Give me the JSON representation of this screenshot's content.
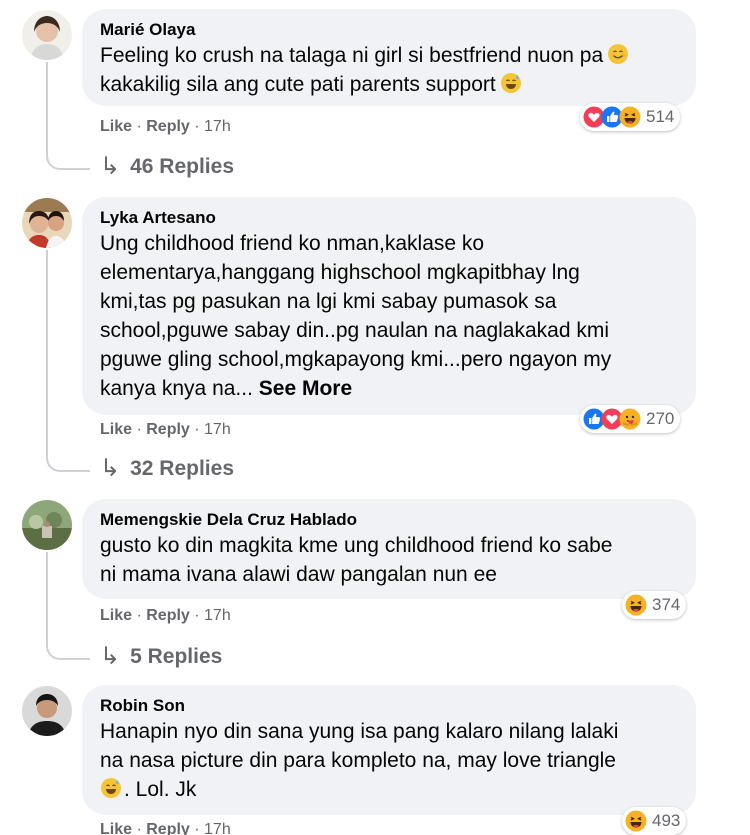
{
  "comments": [
    {
      "author": "Marié Olaya",
      "lines": [
        "Feeling ko crush na talaga ni girl si bestfriend nuon pa",
        "kakakilig sila ang cute pati parents support"
      ],
      "reaction_count": "514",
      "like_label": "Like",
      "reply_label": "Reply",
      "time": "17h",
      "replies_label": "46 Replies"
    },
    {
      "author": "Lyka Artesano",
      "lines": [
        "Ung childhood friend ko nman,kaklase ko",
        "elementarya,hanggang highschool mgkapitbhay lng",
        "kmi,tas pg pasukan na lgi kmi sabay pumasok sa",
        "school,pguwe sabay din..pg naulan na naglakakad kmi",
        "pguwe gling school,mgkapayong kmi...pero ngayon my",
        "kanya knya na..."
      ],
      "see_more": "See More",
      "reaction_count": "270",
      "like_label": "Like",
      "reply_label": "Reply",
      "time": "17h",
      "replies_label": "32 Replies"
    },
    {
      "author": "Memengskie Dela Cruz Hablado",
      "lines": [
        "gusto ko din magkita kme ung childhood friend ko sabe",
        "ni mama ivana alawi daw pangalan nun ee"
      ],
      "reaction_count": "374",
      "like_label": "Like",
      "reply_label": "Reply",
      "time": "17h",
      "replies_label": "5 Replies"
    },
    {
      "author": "Robin Son",
      "lines": [
        "Hanapin nyo din sana yung isa pang kalaro nilang lalaki",
        "na nasa picture din para kompleto na, may love triangle",
        ". Lol. Jk"
      ],
      "reaction_count": "493",
      "like_label": "Like",
      "reply_label": "Reply",
      "time": "17h"
    }
  ],
  "colors": {
    "bubble": "#f0f2f5",
    "meta": "#65676b",
    "love": "#f33e58",
    "like": "#1877f2",
    "haha": "#f7b125"
  },
  "icons": [
    "love-reaction-icon",
    "like-reaction-icon",
    "haha-reaction-icon",
    "care-reaction-icon",
    "smile-emoji-icon",
    "sweat-smile-emoji-icon",
    "reply-arrow-icon"
  ]
}
